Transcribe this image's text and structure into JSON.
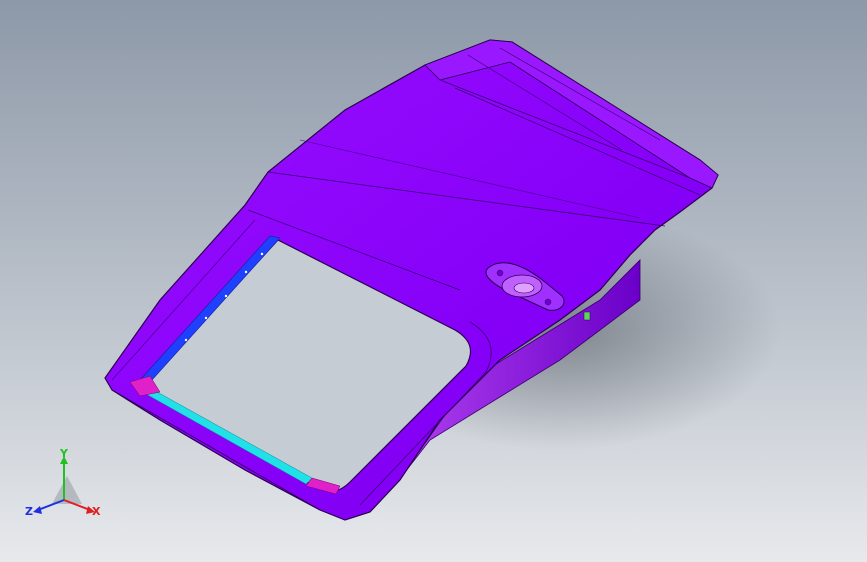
{
  "viewport": {
    "background_top": "#8d98a8",
    "background_bottom": "#e7e9ec"
  },
  "model": {
    "part_color": "#8a00ff",
    "part_highlight": "#b040ff",
    "part_shadow": "#5a00b0",
    "edge_color": "#2a0050",
    "flange_cyan": "#22e0e8",
    "flange_blue": "#2040ff",
    "flange_magenta": "#e020c8"
  },
  "triad": {
    "x_label": "X",
    "y_label": "Y",
    "z_label": "Z",
    "x_color": "#e02020",
    "y_color": "#20c020",
    "z_color": "#2030e0"
  }
}
